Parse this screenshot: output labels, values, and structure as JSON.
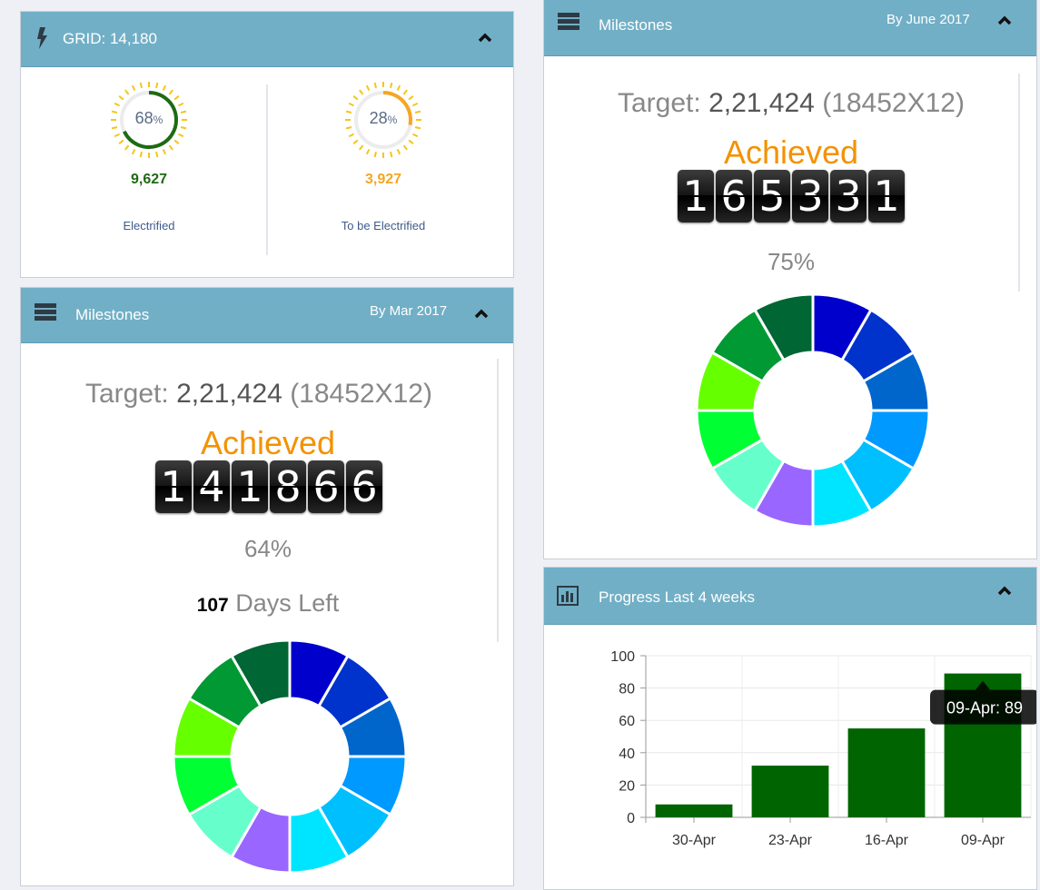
{
  "grid_panel": {
    "title": "GRID: 14,180",
    "electrified": {
      "percent": 68,
      "percent_label": "68",
      "percent_sign": "%",
      "count": "9,627",
      "label": "Electrified",
      "color": "#1d6b12"
    },
    "to_be_electrified": {
      "percent": 28,
      "percent_label": "28",
      "percent_sign": "%",
      "count": "3,927",
      "label": "To be Electrified",
      "color": "#f5a623"
    }
  },
  "milestones_mar": {
    "title": "Milestones",
    "period": "By Mar 2017",
    "target_prefix": "Target:",
    "target_value": "2,21,424",
    "target_formula": "(18452X12)",
    "achieved_label": "Achieved",
    "achieved_digits": [
      "1",
      "4",
      "1",
      "8",
      "6",
      "6"
    ],
    "percent": "64%",
    "days_left_value": "107",
    "days_left_label": "Days Left"
  },
  "milestones_june": {
    "title": "Milestones",
    "period": "By June 2017",
    "target_prefix": "Target:",
    "target_value": "2,21,424",
    "target_formula": "(18452X12)",
    "achieved_label": "Achieved",
    "achieved_digits": [
      "1",
      "6",
      "5",
      "3",
      "3",
      "1"
    ],
    "percent": "75%"
  },
  "donut_colors": [
    "#0000cc",
    "#0033cc",
    "#0066cc",
    "#0099ff",
    "#00bfff",
    "#00e5ff",
    "#9966ff",
    "#66ffcc",
    "#00ff33",
    "#66ff00",
    "#009933",
    "#006633"
  ],
  "progress_panel": {
    "title": "Progress Last 4 weeks",
    "tooltip": "09-Apr: 89"
  },
  "chart_data": {
    "type": "bar",
    "categories": [
      "30-Apr",
      "23-Apr",
      "16-Apr",
      "09-Apr"
    ],
    "values": [
      8,
      32,
      55,
      89
    ],
    "yticks": [
      "0",
      "20",
      "40",
      "60",
      "80",
      "100"
    ],
    "ylim": [
      0,
      100
    ],
    "color": "#006400",
    "grid": true
  },
  "icons": {
    "bolt": "bolt-icon",
    "server": "server-icon",
    "bar_chart": "bar-chart-icon",
    "chevron": "chevron-up-icon"
  }
}
